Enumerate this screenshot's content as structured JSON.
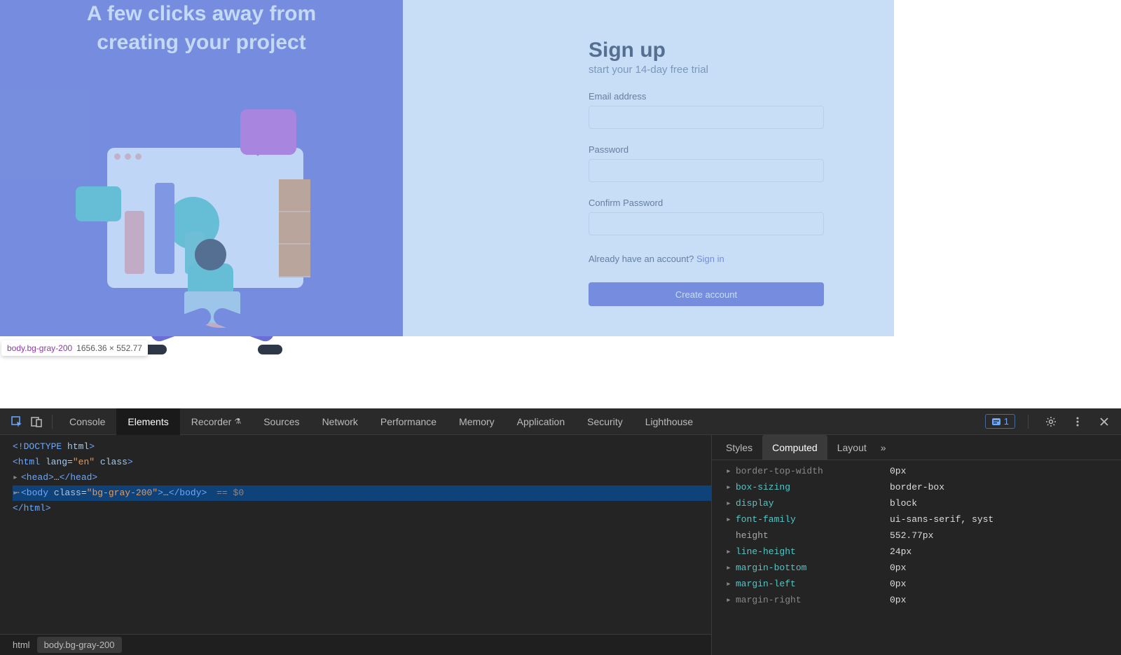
{
  "page": {
    "left": {
      "title_line1": "A few clicks away from",
      "title_line2": "creating your project"
    },
    "signup": {
      "title": "Sign up",
      "subtitle": "start your 14-day free trial",
      "email_label": "Email address",
      "password_label": "Password",
      "confirm_label": "Confirm Password",
      "already_text": "Already have an account? ",
      "signin_link": "Sign in",
      "button": "Create account"
    }
  },
  "tooltip": {
    "selector": "body.bg-gray-200",
    "dims": "1656.36 × 552.77"
  },
  "devtools": {
    "tabs": [
      "Console",
      "Elements",
      "Recorder",
      "Sources",
      "Network",
      "Performance",
      "Memory",
      "Application",
      "Security",
      "Lighthouse"
    ],
    "active_tab": "Elements",
    "issues_count": "1",
    "tree": {
      "doctype": "<!DOCTYPE html>",
      "html_open": "<html lang=\"en\" class>",
      "head": "<head>…</head>",
      "body": "<body class=\"bg-gray-200\">…</body>",
      "body_hint": " == $0",
      "html_close": "</html>"
    },
    "crumbs": {
      "first": "html",
      "second_tag": "body",
      "second_cls": ".bg-gray-200"
    },
    "side_tabs": [
      "Styles",
      "Computed",
      "Layout"
    ],
    "side_active": "Computed",
    "computed": [
      {
        "name": "border-top-width",
        "value": "0px",
        "expandable": true,
        "dim": true
      },
      {
        "name": "box-sizing",
        "value": "border-box",
        "expandable": true
      },
      {
        "name": "display",
        "value": "block",
        "expandable": true
      },
      {
        "name": "font-family",
        "value": "ui-sans-serif, syst",
        "expandable": true
      },
      {
        "name": "height",
        "value": "552.77px",
        "expandable": false
      },
      {
        "name": "line-height",
        "value": "24px",
        "expandable": true
      },
      {
        "name": "margin-bottom",
        "value": "0px",
        "expandable": true
      },
      {
        "name": "margin-left",
        "value": "0px",
        "expandable": true
      },
      {
        "name": "margin-right",
        "value": "0px",
        "expandable": true,
        "dim": true
      }
    ]
  }
}
